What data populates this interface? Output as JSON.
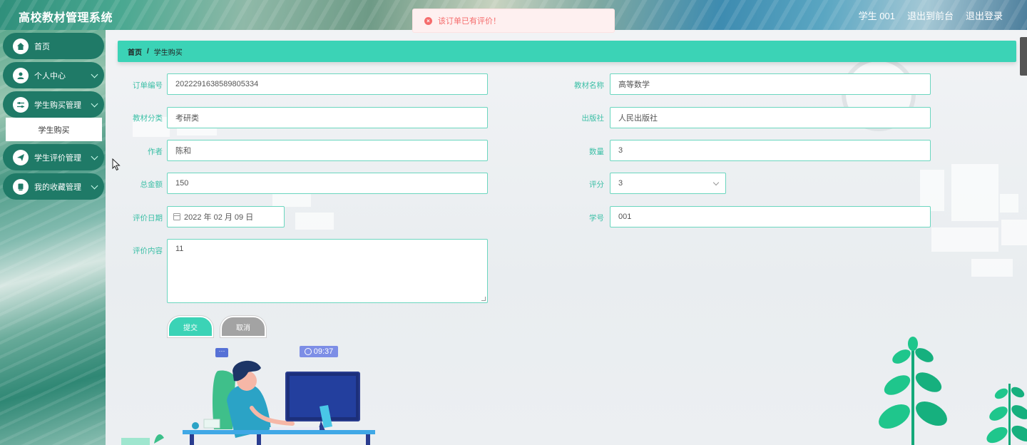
{
  "header": {
    "app_title": "高校教材管理系统",
    "user_label": "学生 001",
    "back_to_front": "退出到前台",
    "logout": "退出登录"
  },
  "toast": {
    "message": "该订单已有评价！",
    "type": "error"
  },
  "sidebar": {
    "items": [
      {
        "label": "首页",
        "icon": "home-icon",
        "has_children": false
      },
      {
        "label": "个人中心",
        "icon": "user-icon",
        "has_children": true
      },
      {
        "label": "学生购买管理",
        "icon": "sliders-icon",
        "has_children": true,
        "expanded": true
      },
      {
        "label": "学生评价管理",
        "icon": "send-icon",
        "has_children": true
      },
      {
        "label": "我的收藏管理",
        "icon": "bookmark-icon",
        "has_children": true
      }
    ],
    "active_sub_item": "学生购买"
  },
  "breadcrumb": {
    "home": "首页",
    "separator": "/",
    "current": "学生购买"
  },
  "form": {
    "order_no": {
      "label": "订单编号",
      "value": "2022291638589805334"
    },
    "book_name": {
      "label": "教材名称",
      "value": "高等数学"
    },
    "category": {
      "label": "教材分类",
      "value": "考研类"
    },
    "publisher": {
      "label": "出版社",
      "value": "人民出版社"
    },
    "author": {
      "label": "作者",
      "value": "陈和"
    },
    "quantity": {
      "label": "数量",
      "value": "3"
    },
    "total": {
      "label": "总金额",
      "value": "150"
    },
    "rating": {
      "label": "评分",
      "value": "3"
    },
    "review_date": {
      "label": "评价日期",
      "value": "2022 年 02 月 09 日"
    },
    "student_no": {
      "label": "学号",
      "value": "001"
    },
    "review_content": {
      "label": "评价内容",
      "value": "11"
    },
    "submit_label": "提交",
    "cancel_label": "取消"
  },
  "illustration": {
    "time": "09:37"
  },
  "colors": {
    "accent": "#3bd3b6",
    "sidebar_item_bg": "#1f7a67",
    "error": "#f56c6c",
    "cancel_button": "#a3a3a3"
  }
}
